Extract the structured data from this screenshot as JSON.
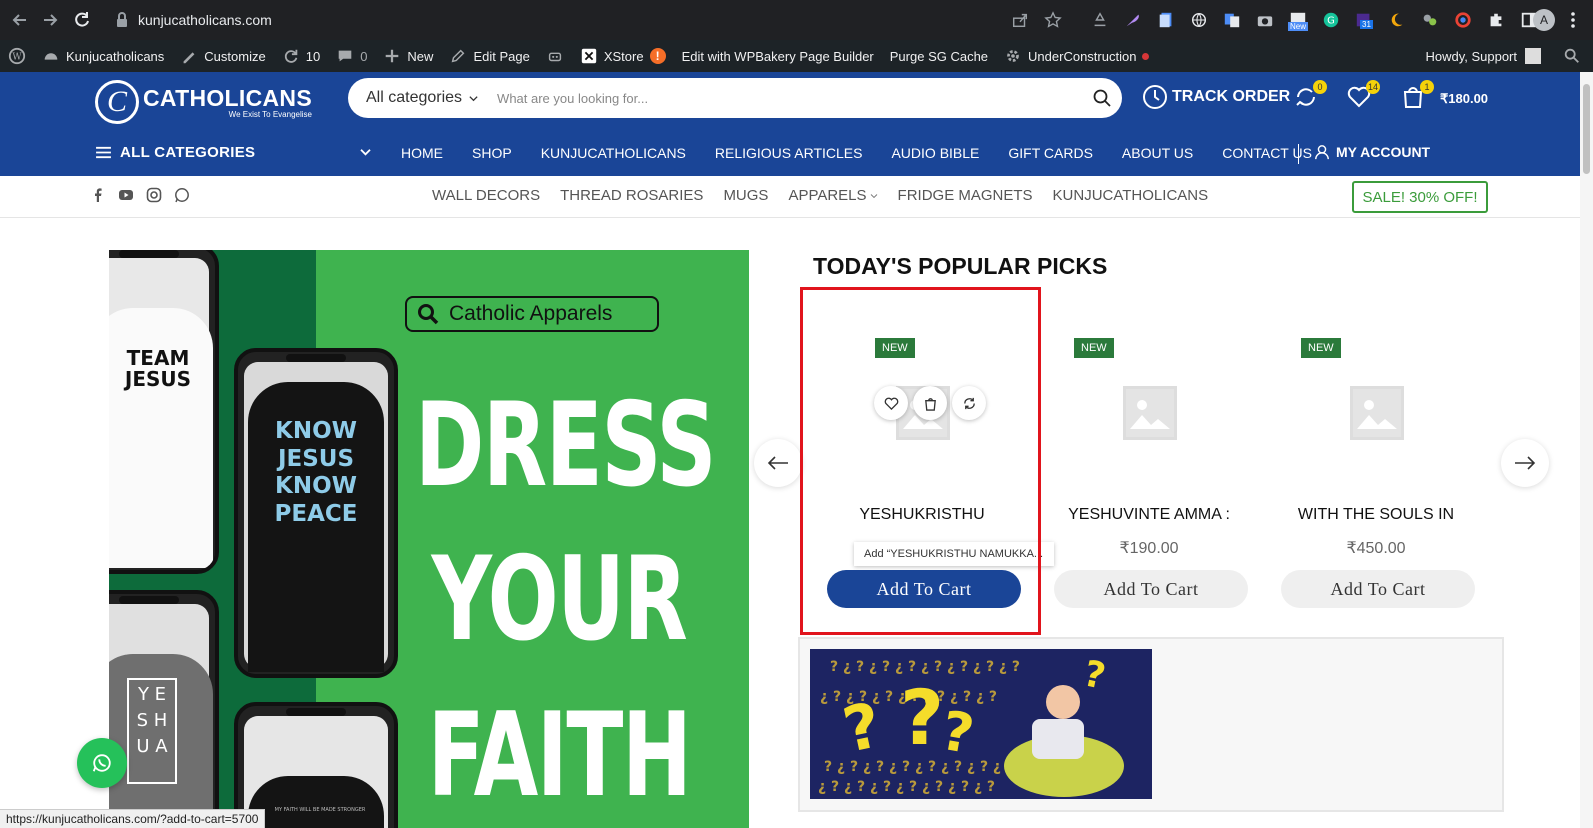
{
  "browser": {
    "url": "kunjucatholicans.com",
    "profile_initial": "A",
    "ext_new_label": "New",
    "ext_calendar_label": "31"
  },
  "adminbar": {
    "site_name": "Kunjucatholicans",
    "customize": "Customize",
    "updates_count": "10",
    "comments_count": "0",
    "new_label": "New",
    "edit_page": "Edit Page",
    "xstore": "XStore",
    "xstore_alert": "!",
    "wpbakery": "Edit with WPBakery Page Builder",
    "purge_cache": "Purge SG Cache",
    "under_construction": "UnderConstruction",
    "howdy": "Howdy, Support"
  },
  "header": {
    "logo_initial": "C",
    "logo_name": "CATHOLICANS",
    "logo_tagline": "We Exist To Evangelise",
    "search_category": "All categories",
    "search_placeholder": "What are you looking for...",
    "track_order": "TRACK ORDER",
    "compare_count": "0",
    "wishlist_count": "14",
    "cart_count": "1",
    "cart_total": "₹180.00",
    "all_categories": "ALL CATEGORIES",
    "nav": [
      "HOME",
      "SHOP",
      "KUNJUCATHOLICANS",
      "RELIGIOUS ARTICLES",
      "AUDIO BIBLE",
      "GIFT CARDS",
      "ABOUT US",
      "CONTACT US"
    ],
    "my_account": "MY ACCOUNT"
  },
  "subnav": {
    "links": [
      "WALL DECORS",
      "THREAD ROSARIES",
      "MUGS",
      "APPARELS",
      "FRIDGE MAGNETS",
      "KUNJUCATHOLICANS"
    ],
    "sale_button": "SALE! 30% OFF!"
  },
  "banner": {
    "search_text": "Catholic Apparels",
    "shirt1": "TEAM JESUS",
    "shirt2": [
      "KNOW",
      "JESUS",
      "KNOW",
      "PEACE"
    ],
    "shirt3": [
      "Y E",
      "S H",
      "U A"
    ],
    "shirt4": "MY FAITH WILL BE MADE STRONGER",
    "words": [
      "DRESS",
      "YOUR",
      "FAITH"
    ]
  },
  "popular": {
    "title": "TODAY'S POPULAR PICKS",
    "products": [
      {
        "badge": "NEW",
        "name": "YESHUKRISTHU",
        "price": "",
        "tooltip": "Add “YESHUKRISTHU NAMUKKA...",
        "button": "Add To Cart"
      },
      {
        "badge": "NEW",
        "name": "YESHUVINTE AMMA :",
        "price": "₹190.00",
        "button": "Add To Cart"
      },
      {
        "badge": "NEW",
        "name": "WITH THE SOULS IN",
        "price": "₹450.00",
        "button": "Add To Cart"
      }
    ]
  },
  "statusbar": {
    "url": "https://kunjucatholicans.com/?add-to-cart=5700"
  },
  "colors": {
    "brand_blue": "#1a4597",
    "sale_green": "#3b9c3b",
    "highlight_red": "#e1141c",
    "whatsapp": "#25c15a"
  }
}
